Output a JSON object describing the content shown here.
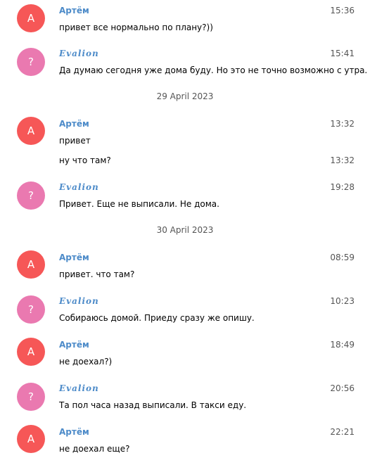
{
  "chat": {
    "names": {
      "artem": "Артём",
      "evalion": "Evalion"
    },
    "avatars": {
      "artem_initial": "A",
      "evalion_initial": "?"
    },
    "colors": {
      "artem_avatar": "#f65757",
      "evalion_avatar": "#ea79b0",
      "sender_name": "#4d8bc9"
    },
    "dates": [
      "29 April 2023",
      "30 April 2023"
    ],
    "messages": [
      {
        "time": "15:36",
        "text": "привет все нормально по плану?))"
      },
      {
        "time": "15:41",
        "text": "Да думаю сегодня уже дома буду. Но это не точно возможно с утра."
      },
      {
        "time": "13:32",
        "text": "привет"
      },
      {
        "time": "13:32",
        "text": "ну что там?"
      },
      {
        "time": "19:28",
        "text": "Привет. Еще не выписали. Не дома."
      },
      {
        "time": "08:59",
        "text": "привет. что там?"
      },
      {
        "time": "10:23",
        "text": "Собираюсь домой. Приеду сразу же опишу."
      },
      {
        "time": "18:49",
        "text": "не доехал?)"
      },
      {
        "time": "20:56",
        "text": "Та пол часа назад выписали. В такси еду."
      },
      {
        "time": "22:21",
        "text": "не доехал еще?"
      }
    ]
  }
}
